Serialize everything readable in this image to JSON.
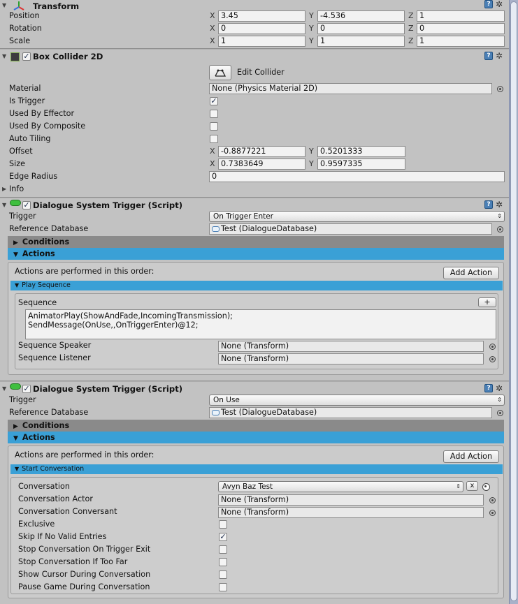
{
  "transform": {
    "title": "Transform",
    "rows": [
      {
        "label": "Position",
        "x": "3.45",
        "y": "-4.536",
        "z": "1"
      },
      {
        "label": "Rotation",
        "x": "0",
        "y": "0",
        "z": "0"
      },
      {
        "label": "Scale",
        "x": "1",
        "y": "1",
        "z": "1"
      }
    ]
  },
  "axes": {
    "x": "X",
    "y": "Y",
    "z": "Z"
  },
  "box_collider": {
    "title": "Box Collider 2D",
    "enabled": true,
    "edit_collider_label": "Edit Collider",
    "material_label": "Material",
    "material_value": "None (Physics Material 2D)",
    "is_trigger_label": "Is Trigger",
    "is_trigger": true,
    "used_by_effector_label": "Used By Effector",
    "used_by_composite_label": "Used By Composite",
    "auto_tiling_label": "Auto Tiling",
    "offset_label": "Offset",
    "offset_x": "-0.8877221",
    "offset_y": "0.5201333",
    "size_label": "Size",
    "size_x": "0.7383649",
    "size_y": "0.9597335",
    "edge_radius_label": "Edge Radius",
    "edge_radius": "0",
    "info_label": "Info"
  },
  "trigger1": {
    "title": "Dialogue System Trigger (Script)",
    "trigger_label": "Trigger",
    "trigger_value": "On Trigger Enter",
    "db_label": "Reference Database",
    "db_value": "Test (DialogueDatabase)",
    "conditions_label": "Conditions",
    "actions_label": "Actions",
    "order_text": "Actions are performed in this order:",
    "add_action": "Add Action",
    "play_sequence_label": "Play Sequence",
    "sequence_label": "Sequence",
    "plus": "+",
    "sequence_line1": "AnimatorPlay(ShowAndFade,IncomingTransmission);",
    "sequence_line2": "SendMessage(OnUse,,OnTriggerEnter)@12;",
    "speaker_label": "Sequence Speaker",
    "speaker_value": "None (Transform)",
    "listener_label": "Sequence Listener",
    "listener_value": "None (Transform)"
  },
  "trigger2": {
    "title": "Dialogue System Trigger (Script)",
    "trigger_label": "Trigger",
    "trigger_value": "On Use",
    "db_label": "Reference Database",
    "db_value": "Test (DialogueDatabase)",
    "conditions_label": "Conditions",
    "actions_label": "Actions",
    "order_text": "Actions are performed in this order:",
    "add_action": "Add Action",
    "start_conv_label": "Start Conversation",
    "conversation_label": "Conversation",
    "conversation_value": "Avyn Baz Test",
    "clear": "x",
    "actor_label": "Conversation Actor",
    "actor_value": "None (Transform)",
    "conversant_label": "Conversation Conversant",
    "conversant_value": "None (Transform)",
    "exclusive_label": "Exclusive",
    "skip_label": "Skip If No Valid Entries",
    "skip_checked": true,
    "stop_exit_label": "Stop Conversation On Trigger Exit",
    "stop_far_label": "Stop Conversation If Too Far",
    "show_cursor_label": "Show Cursor During Conversation",
    "pause_label": "Pause Game During Conversation"
  },
  "icons": {
    "help": "?",
    "gear": "✲",
    "check": "✓",
    "dropdown_arrow": "▾",
    "updown_arrow": "⇕",
    "expand": "▶",
    "collapse": "▼"
  },
  "colors": {
    "accent_blue": "#3aa0d6",
    "section_gray": "#8a8a8a",
    "background": "#c2c2c2"
  }
}
